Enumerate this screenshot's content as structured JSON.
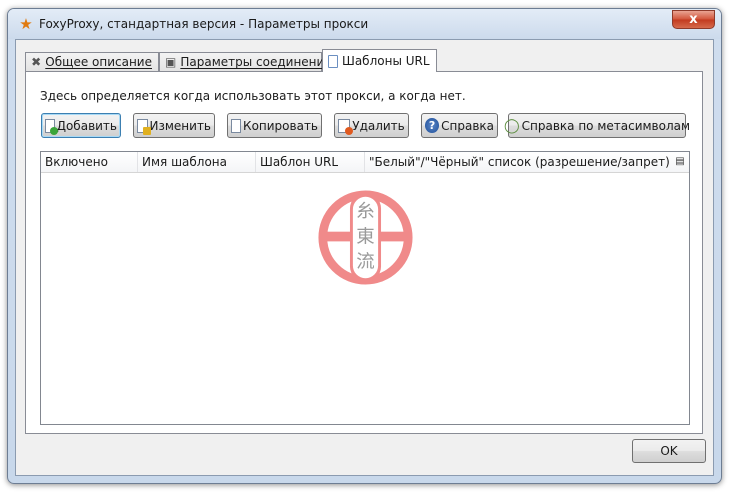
{
  "window": {
    "title": "FoxyProxy, стандартная версия - Параметры прокси",
    "title_icon": "foxyproxy-icon",
    "close_label": "x"
  },
  "tabs": [
    {
      "label": "Общее описание",
      "icon": "tools-icon",
      "active": false
    },
    {
      "label": "Параметры соединения",
      "icon": "computer-icon",
      "active": false
    },
    {
      "label": "Шаблоны URL",
      "icon": "document-icon",
      "active": true
    }
  ],
  "panel": {
    "description": "Здесь определяется когда использовать этот прокси, а когда нет."
  },
  "toolbar": {
    "add": "Добавить",
    "edit": "Изменить",
    "copy": "Копировать",
    "delete": "Удалить",
    "help": "Справка",
    "wildcard_help": "Справка по метасимволам"
  },
  "table": {
    "columns": [
      "Включено",
      "Имя шаблона",
      "Шаблон URL",
      "\"Белый\"/\"Чёрный\" список (разрешение/запрет)"
    ],
    "rows": []
  },
  "watermark": {
    "chars": [
      "糸",
      "東",
      "流"
    ],
    "color": "#f08080"
  },
  "footer": {
    "ok": "OK"
  }
}
